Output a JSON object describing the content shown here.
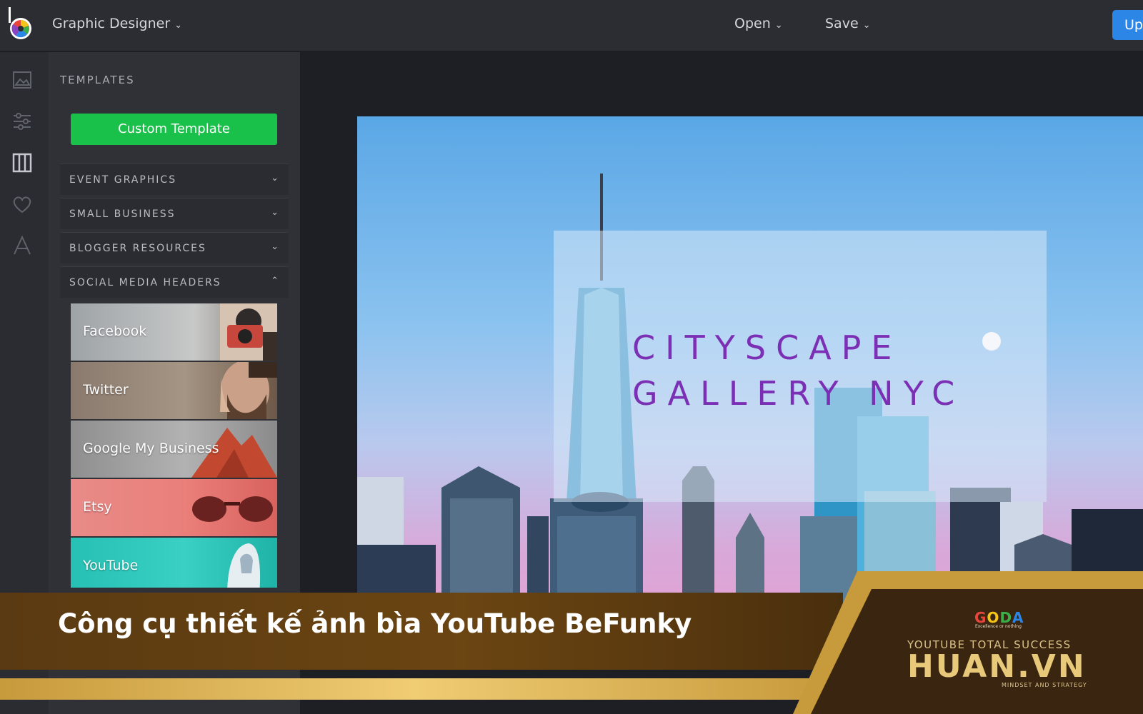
{
  "app": {
    "title": "Graphic Designer",
    "menus": {
      "open": "Open",
      "save": "Save"
    },
    "upgrade_label": "Up"
  },
  "panel": {
    "heading": "TEMPLATES",
    "custom_button": "Custom Template",
    "categories": [
      {
        "label": "EVENT GRAPHICS",
        "state": "collapsed"
      },
      {
        "label": "SMALL BUSINESS",
        "state": "collapsed"
      },
      {
        "label": "BLOGGER RESOURCES",
        "state": "collapsed"
      },
      {
        "label": "SOCIAL MEDIA HEADERS",
        "state": "expanded"
      }
    ],
    "templates": [
      {
        "label": "Facebook"
      },
      {
        "label": "Twitter"
      },
      {
        "label": "Google My Business"
      },
      {
        "label": "Etsy"
      },
      {
        "label": "YouTube"
      }
    ]
  },
  "canvas": {
    "headline_line1": "CITYSCAPE",
    "headline_line2": "GALLERY NYC"
  },
  "overlay": {
    "caption": "Công cụ thiết kế ảnh bìa YouTube BeFunky",
    "brand_tagline": "YOUTUBE TOTAL SUCCESS",
    "brand_name": "HUAN.VN",
    "brand_sub": "MINDSET AND STRATEGY",
    "partner_logo": "GODA",
    "partner_sub": "Excellence or nothing"
  },
  "colors": {
    "accent_green": "#19c14a",
    "upgrade_blue": "#2b86e6",
    "headline_purple": "#7b2fb4",
    "banner_gold": "#e8c879"
  }
}
